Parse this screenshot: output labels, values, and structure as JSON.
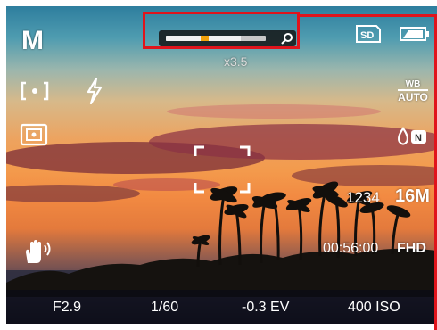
{
  "camera": {
    "mode": "M",
    "zoom": {
      "ratio_text": "x3.5",
      "level_fraction": 0.35
    },
    "right_column": {
      "wb_top": "WB",
      "wb_bottom": "AUTO"
    },
    "shots_remaining": "1234",
    "resolution": "16M",
    "record_time": "00:56:00",
    "video_quality": "FHD",
    "exposure_bar": {
      "aperture": "F2.9",
      "shutter": "1/60",
      "ev": "-0.3 EV",
      "iso": "400 ISO"
    },
    "icons": [
      "metering-spot-icon",
      "flash-icon",
      "face-detect-icon",
      "stabilizer-hand-icon",
      "sd-card-icon",
      "battery-icon",
      "white-balance-icon",
      "color-mode-icon",
      "zoom-magnifier-icon"
    ],
    "colors": {
      "highlight_red": "#e0141c",
      "zoom_marker": "#f2a20c"
    }
  }
}
